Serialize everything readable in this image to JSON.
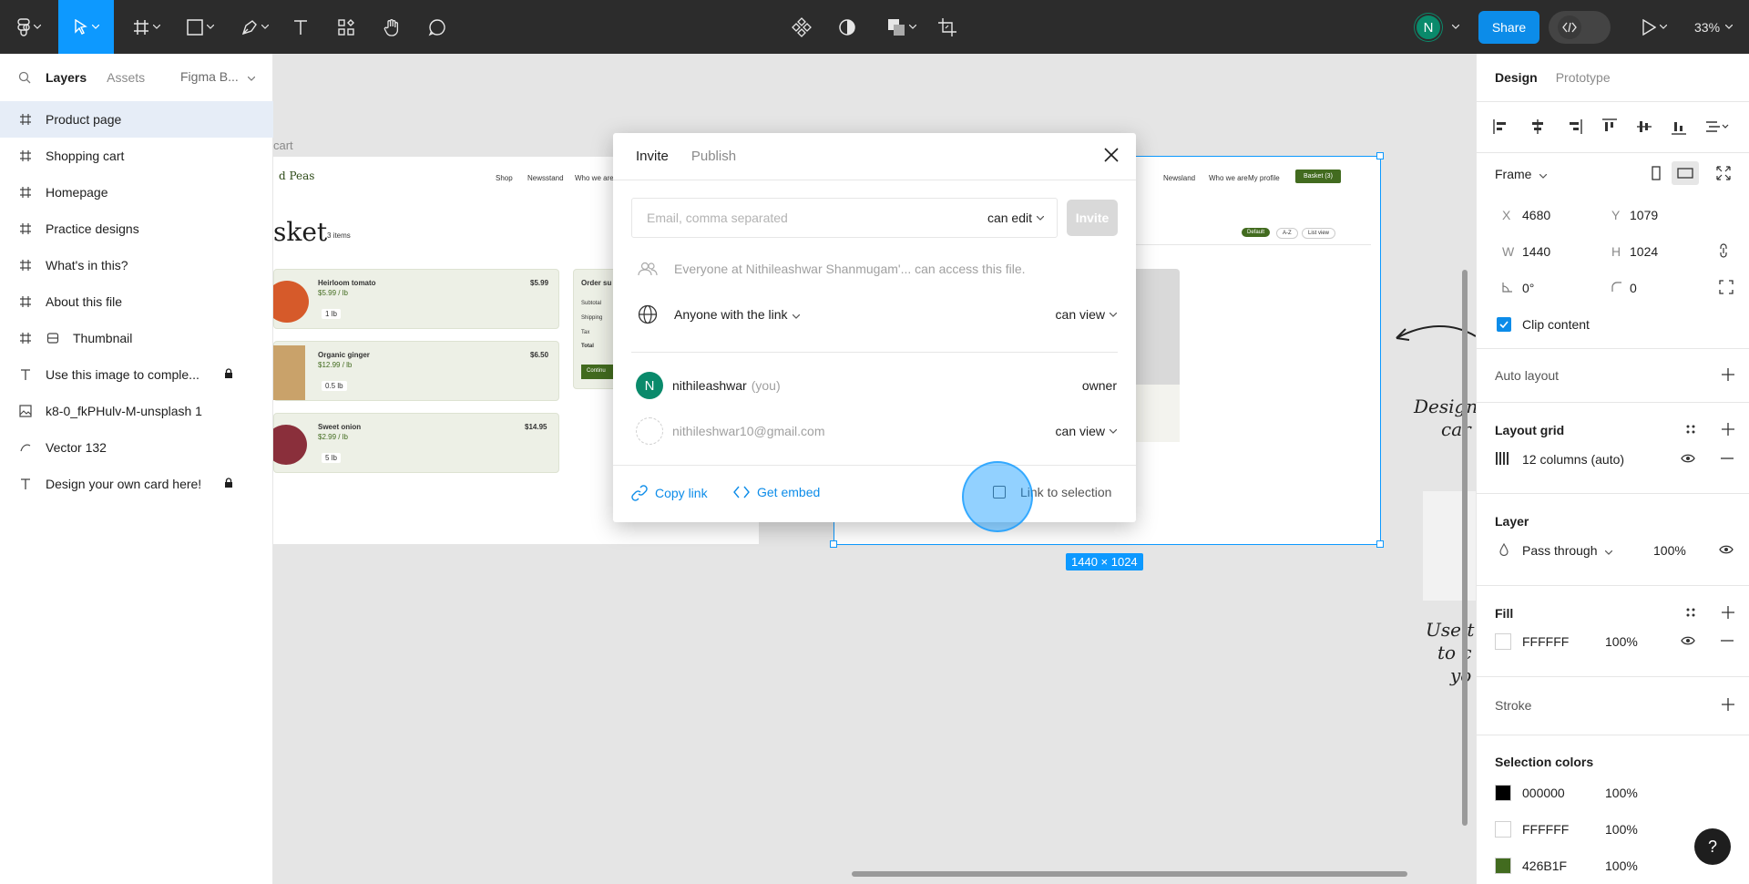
{
  "toolbar": {
    "zoom": "33%",
    "share_label": "Share",
    "user_initial": "N"
  },
  "left_panel": {
    "tabs": {
      "layers": "Layers",
      "assets": "Assets",
      "page": "Figma B..."
    },
    "layers": [
      {
        "name": "Product page",
        "icon": "frame-icon",
        "selected": true
      },
      {
        "name": "Shopping cart",
        "icon": "frame-icon"
      },
      {
        "name": "Homepage",
        "icon": "frame-icon"
      },
      {
        "name": "Practice designs",
        "icon": "frame-icon"
      },
      {
        "name": "What's in this?",
        "icon": "frame-icon"
      },
      {
        "name": "About this file",
        "icon": "frame-icon"
      },
      {
        "name": "Thumbnail",
        "icon": "component-icon"
      },
      {
        "name": "Use this image to comple...",
        "icon": "text-icon",
        "locked": true
      },
      {
        "name": "k8-0_fkPHulv-M-unsplash 1",
        "icon": "image-icon"
      },
      {
        "name": "Vector 132",
        "icon": "vector-icon"
      },
      {
        "name": "Design your own card here!",
        "icon": "text-icon",
        "locked": true
      }
    ]
  },
  "canvas": {
    "frame_label": "cart",
    "size_badge": "1440 × 1024",
    "handwriting_1": "Design",
    "handwriting_2": "car",
    "handwriting_3": "Use t",
    "handwriting_4": "to c",
    "handwriting_5": "yo",
    "mock": {
      "brand": "d Peas",
      "nav": [
        "Shop",
        "Newsstand",
        "Who we are"
      ],
      "nav_right": [
        "Newsland",
        "Who we are",
        "My profile"
      ],
      "basket_btn": "Basket (3)",
      "heading": "sket",
      "count": "3 items",
      "sort": [
        "Default",
        "A-Z",
        "List view"
      ],
      "items": [
        {
          "name": "Heirloom tomato",
          "price": "$5.99 / lb",
          "qty": "1 lb",
          "total": "$5.99"
        },
        {
          "name": "Organic ginger",
          "price": "$12.99 / lb",
          "qty": "0.5 lb",
          "total": "$6.50"
        },
        {
          "name": "Sweet onion",
          "price": "$2.99 / lb",
          "qty": "5 lb",
          "total": "$14.95"
        }
      ],
      "summary_title": "Order su",
      "summary_rows": [
        "Subtotal",
        "Shipping",
        "Tax",
        "Total"
      ],
      "continue": "Continu"
    }
  },
  "modal": {
    "tabs": {
      "invite": "Invite",
      "publish": "Publish"
    },
    "email_placeholder": "Email, comma separated",
    "permission": "can edit",
    "invite_label": "Invite",
    "org_access_text": "Everyone at Nithileashwar Shanmugam'... can access this file.",
    "link_access_label": "Anyone with the link",
    "link_access_perm": "can view",
    "users": [
      {
        "name": "nithileashwar",
        "suffix": "(you)",
        "role": "owner",
        "initial": "N"
      },
      {
        "name": "nithileshwar10@gmail.com",
        "role": "can view"
      }
    ],
    "copy_link": "Copy link",
    "get_embed": "Get embed",
    "link_to_selection": "Link to selection"
  },
  "right_panel": {
    "tabs": {
      "design": "Design",
      "prototype": "Prototype"
    },
    "frame_label": "Frame",
    "x": "4680",
    "y": "1079",
    "w": "1440",
    "h": "1024",
    "rotation": "0°",
    "radius": "0",
    "labels": {
      "x": "X",
      "y": "Y",
      "w": "W",
      "h": "H"
    },
    "clip_content": "Clip content",
    "auto_layout": "Auto layout",
    "layout_grid": "Layout grid",
    "grid_value": "12 columns (auto)",
    "layer_title": "Layer",
    "blend_mode": "Pass through",
    "layer_opacity": "100%",
    "fill_title": "Fill",
    "fill_hex": "FFFFFF",
    "fill_opacity": "100%",
    "stroke_title": "Stroke",
    "selection_colors_title": "Selection colors",
    "selection_colors": [
      {
        "hex": "000000",
        "opacity": "100%",
        "color": "#000000"
      },
      {
        "hex": "FFFFFF",
        "opacity": "100%",
        "color": "#FFFFFF"
      },
      {
        "hex": "426B1F",
        "opacity": "100%",
        "color": "#426B1F"
      }
    ],
    "help": "?"
  }
}
